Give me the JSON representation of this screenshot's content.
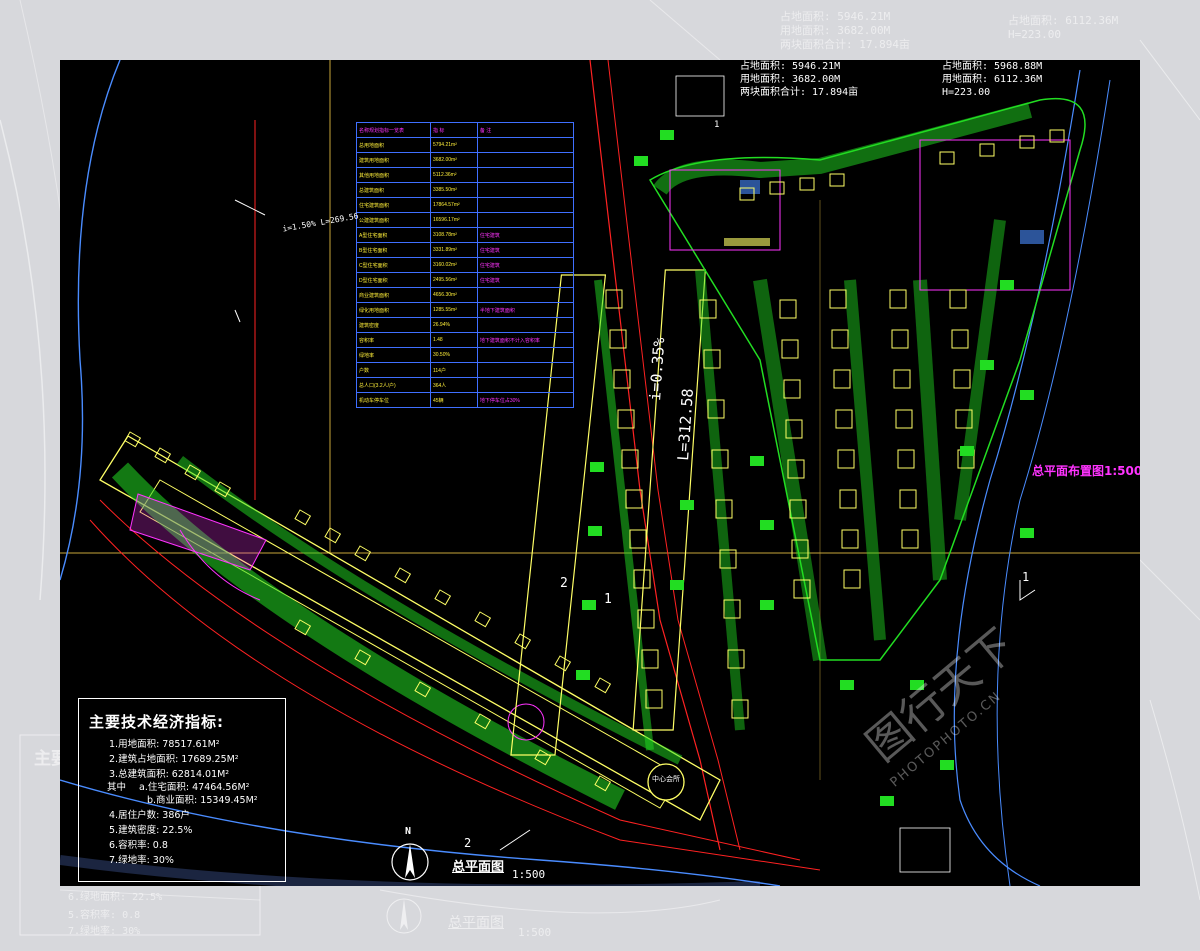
{
  "ghost_text": {
    "top_a1": "占地面积: 5946.21M",
    "top_a2": "用地面积: 3682.00M",
    "top_a3": "两块面积合计: 17.894亩",
    "top_b1": "占地面积: 6112.36M",
    "top_b2": "H=223.00",
    "left_frag": "主要",
    "bottom_l1": "6.绿地面积: 22.5%",
    "bottom_l2": "5.容积率: 0.8",
    "bottom_l3": "7.绿地率: 30%",
    "bottom_title": "总平面图",
    "bottom_scale": "1:500"
  },
  "area_notes": {
    "line1": "占地面积: 5946.21M",
    "line2": "用地面积: 3682.00M",
    "line3": "两块面积合计: 17.894亩",
    "right1": "占地面积: 5968.88M",
    "right2": "用地面积: 6112.36M",
    "right3": "H=223.00"
  },
  "road_labels": {
    "slope": "i=0.35%",
    "length": "L=312.58",
    "marker_1a": "1",
    "marker_2a": "2",
    "marker_1b": "1",
    "marker_2b": "2",
    "marker_1c": "1",
    "left_slope": "i=1.50%\nL=269.56"
  },
  "center_label": "中心会所",
  "magenta_label": "总平面布置图1:500布置图",
  "tech_index": {
    "title": "主要技术经济指标:",
    "items": [
      "1.用地面积: 78517.61M²",
      "2.建筑占地面积: 17689.25M²",
      "3.总建筑面积: 62814.01M²"
    ],
    "sub_prefix": "其中",
    "sub_a": "a.住宅面积: 47464.56M²",
    "sub_b": "b.商业面积: 15349.45M²",
    "items2": [
      "4.居住户数: 386户",
      "5.建筑密度: 22.5%",
      "6.容积率: 0.8",
      "7.绿地率: 30%"
    ]
  },
  "plan_title": "总平面图",
  "plan_scale": "1:500",
  "north": "N",
  "watermark": "图行天下",
  "watermark_en": "PHOTOPHOTO.CN",
  "table": {
    "header": [
      "名称规划指标一览表",
      "指 标",
      "备 注"
    ],
    "rows": [
      [
        "总用地面积",
        "5794.21m²",
        ""
      ],
      [
        "建筑用地面积",
        "3682.00m²",
        ""
      ],
      [
        "其他用地面积",
        "5112.36m²",
        ""
      ],
      [
        "总建筑面积",
        "3385.50m²",
        ""
      ],
      [
        "住宅建筑面积",
        "17864.57m²",
        ""
      ],
      [
        "公建建筑面积",
        "16596.17m²",
        ""
      ],
      [
        "A型住宅面积",
        "3108.78m²",
        "住宅建筑"
      ],
      [
        "B型住宅面积",
        "3331.89m²",
        "住宅建筑"
      ],
      [
        "C型住宅面积",
        "3160.02m²",
        "住宅建筑"
      ],
      [
        "D型住宅面积",
        "2495.56m²",
        "住宅建筑"
      ],
      [
        "商业建筑面积",
        "4656.30m²",
        ""
      ],
      [
        "绿化用地面积",
        "1285.55m²",
        "半地下建筑面积"
      ],
      [
        "建筑密度",
        "26.94%",
        ""
      ],
      [
        "容积率",
        "1.48",
        "地下建筑面积不计入容积率"
      ],
      [
        "绿地率",
        "30.50%",
        ""
      ],
      [
        "户数",
        "114户",
        ""
      ],
      [
        "总人口(3.2人/户)",
        "364人",
        ""
      ],
      [
        "机动车停车位",
        "45辆",
        "地下停车位占30%"
      ]
    ]
  },
  "colors": {
    "background": "#000000",
    "building_outline": "#ffff66",
    "trees": "#22dd22",
    "roads": "#ff2222",
    "water": "#4a8cff",
    "table_grid": "#3f6fff",
    "magenta": "#ff33ff"
  }
}
